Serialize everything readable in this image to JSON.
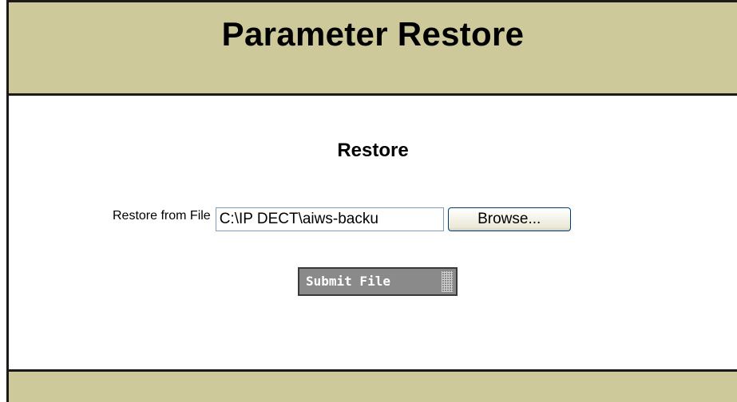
{
  "header": {
    "title": "Parameter Restore"
  },
  "section": {
    "title": "Restore"
  },
  "restore_form": {
    "label": "Restore from File",
    "file_value": "C:\\IP DECT\\aiws-backu",
    "browse_label": "Browse...",
    "submit_label": "Submit File"
  },
  "colors": {
    "band": "#cdc99a",
    "border": "#1a1a1a",
    "submit_bg": "#8a8a8a"
  }
}
